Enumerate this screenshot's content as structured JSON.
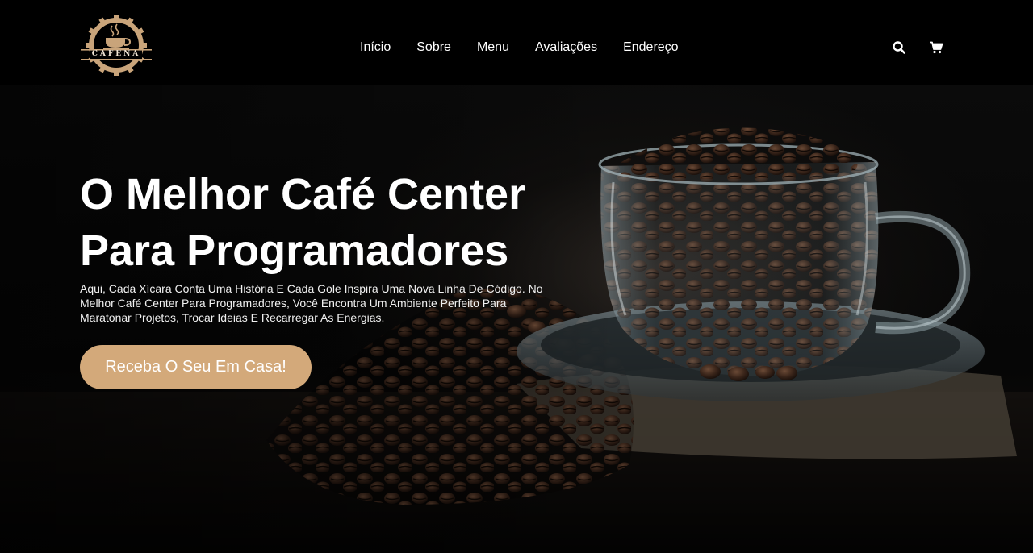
{
  "brand": {
    "logo_text": "CAFENA"
  },
  "nav": {
    "items": [
      {
        "label": "Início"
      },
      {
        "label": "Sobre"
      },
      {
        "label": "Menu"
      },
      {
        "label": "Avaliações"
      },
      {
        "label": "Endereço"
      }
    ]
  },
  "header_icons": {
    "search": "search-icon",
    "cart": "cart-icon"
  },
  "hero": {
    "title_line1": "O Melhor Café Center",
    "title_line2": "Para Programadores",
    "description": "Aqui, Cada Xícara Conta Uma História E Cada Gole Inspira Uma Nova Linha De Código. No Melhor Café Center Para Programadores, Você Encontra Um Ambiente Perfeito Para Maratonar Projetos, Trocar Ideias E Recarregar As Energias.",
    "cta_label": "Receba O Seu Em Casa!"
  },
  "colors": {
    "background": "#000000",
    "accent": "#d3a97a",
    "logo_gold": "#c9a47a",
    "text": "#ffffff"
  }
}
